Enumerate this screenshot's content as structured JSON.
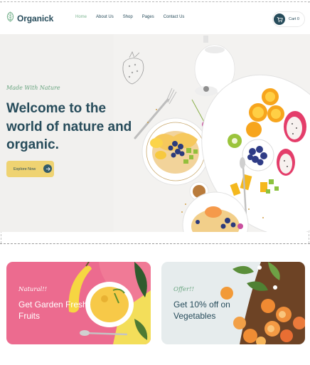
{
  "header": {
    "logo_text": "Organick",
    "nav": [
      {
        "label": "Home",
        "active": true
      },
      {
        "label": "About Us",
        "active": false
      },
      {
        "label": "Shop",
        "active": false
      },
      {
        "label": "Pages",
        "active": false
      },
      {
        "label": "Contact Us",
        "active": false
      }
    ],
    "cart_label": "Cart",
    "cart_count": "0",
    "icons": {
      "logo": "leaf-logo-icon",
      "cart": "cart-icon"
    }
  },
  "hero": {
    "subtitle": "Made With Nature",
    "title": "Welcome to the world of nature and organic.",
    "cta_label": "Explore Now",
    "cta_icon": "arrow-right-icon"
  },
  "promos": [
    {
      "subtitle": "Natural!!",
      "title": "Get Garden Fresh Fruits"
    },
    {
      "subtitle": "Offer!!",
      "title": "Get 10% off on Vegetables"
    }
  ],
  "colors": {
    "brand_dark": "#274c5b",
    "brand_green": "#7eb693",
    "cta_yellow": "#efd372",
    "promo_pink": "#ec6b8f",
    "promo_light": "#e6eced"
  }
}
